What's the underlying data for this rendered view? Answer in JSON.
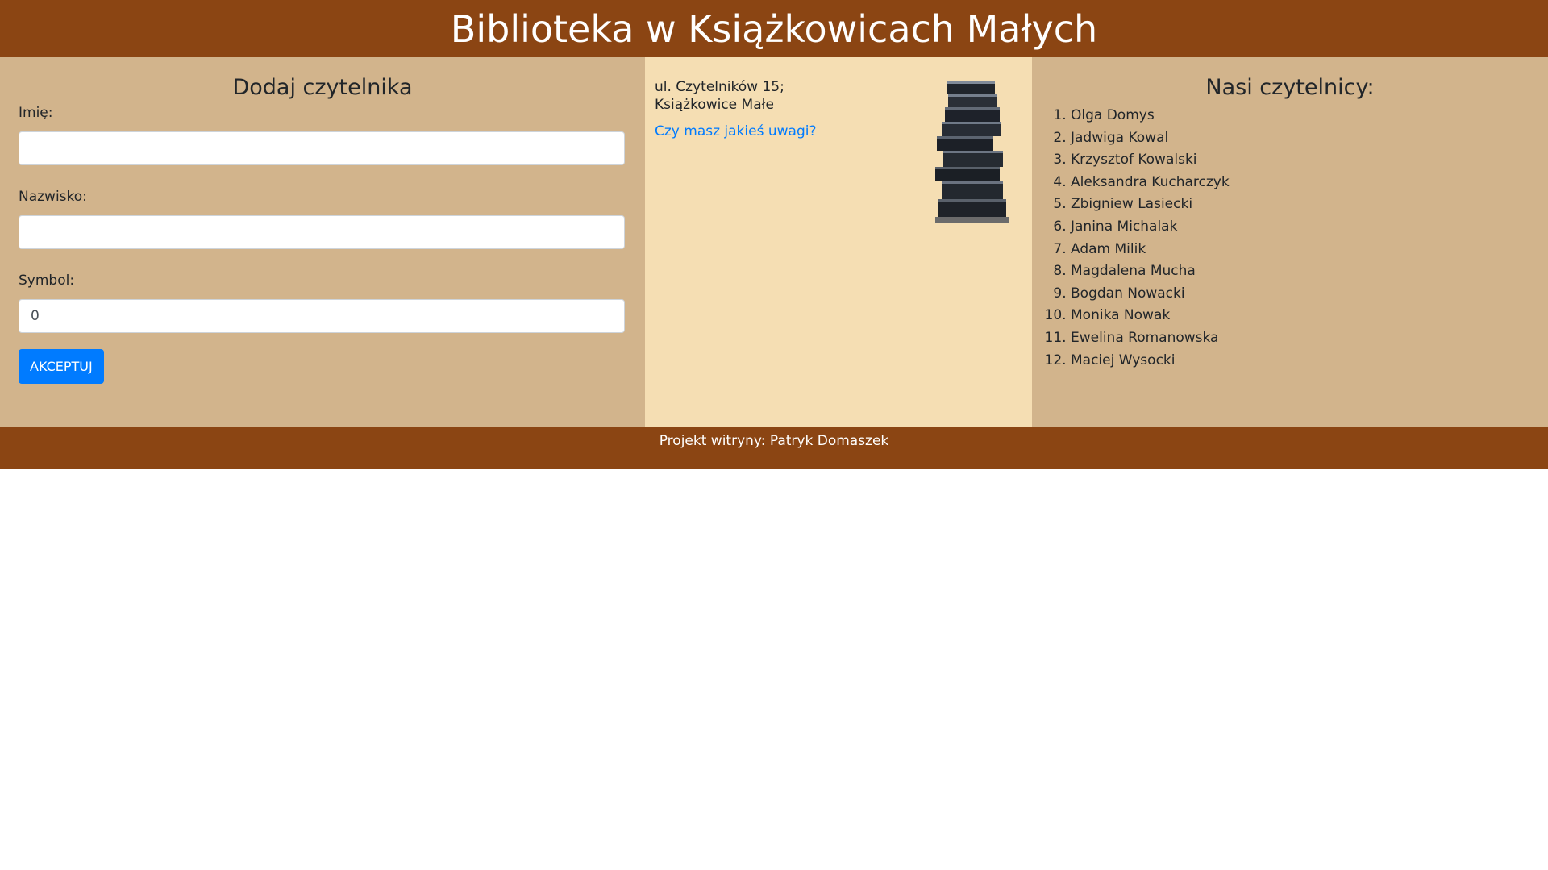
{
  "banner": {
    "title": "Biblioteka w Książkowicach Małych"
  },
  "form": {
    "heading": "Dodaj czytelnika",
    "first_name_label": "Imię:",
    "first_name_value": "",
    "last_name_label": "Nazwisko:",
    "last_name_value": "",
    "symbol_label": "Symbol:",
    "symbol_value": "0",
    "submit_label": "AKCEPTUJ"
  },
  "info": {
    "address_line1": "ul. Czytelników 15;",
    "address_line2": "Książkowice Małe",
    "feedback_link": "Czy masz jakieś uwagi?",
    "image_icon": "stack-of-books-icon"
  },
  "readers": {
    "heading": "Nasi czytelnicy:",
    "items": [
      "Olga Domys",
      "Jadwiga Kowal",
      "Krzysztof Kowalski",
      "Aleksandra Kucharczyk",
      "Zbigniew Lasiecki",
      "Janina Michalak",
      "Adam Milik",
      "Magdalena Mucha",
      "Bogdan Nowacki",
      "Monika Nowak",
      "Ewelina Romanowska",
      "Maciej Wysocki"
    ]
  },
  "footer": {
    "credit": "Projekt witryny: Patryk Domaszek"
  },
  "colors": {
    "brown": "#8b4513",
    "tan": "#d2b48c",
    "wheat": "#f5deb3",
    "accent": "#007bff"
  }
}
